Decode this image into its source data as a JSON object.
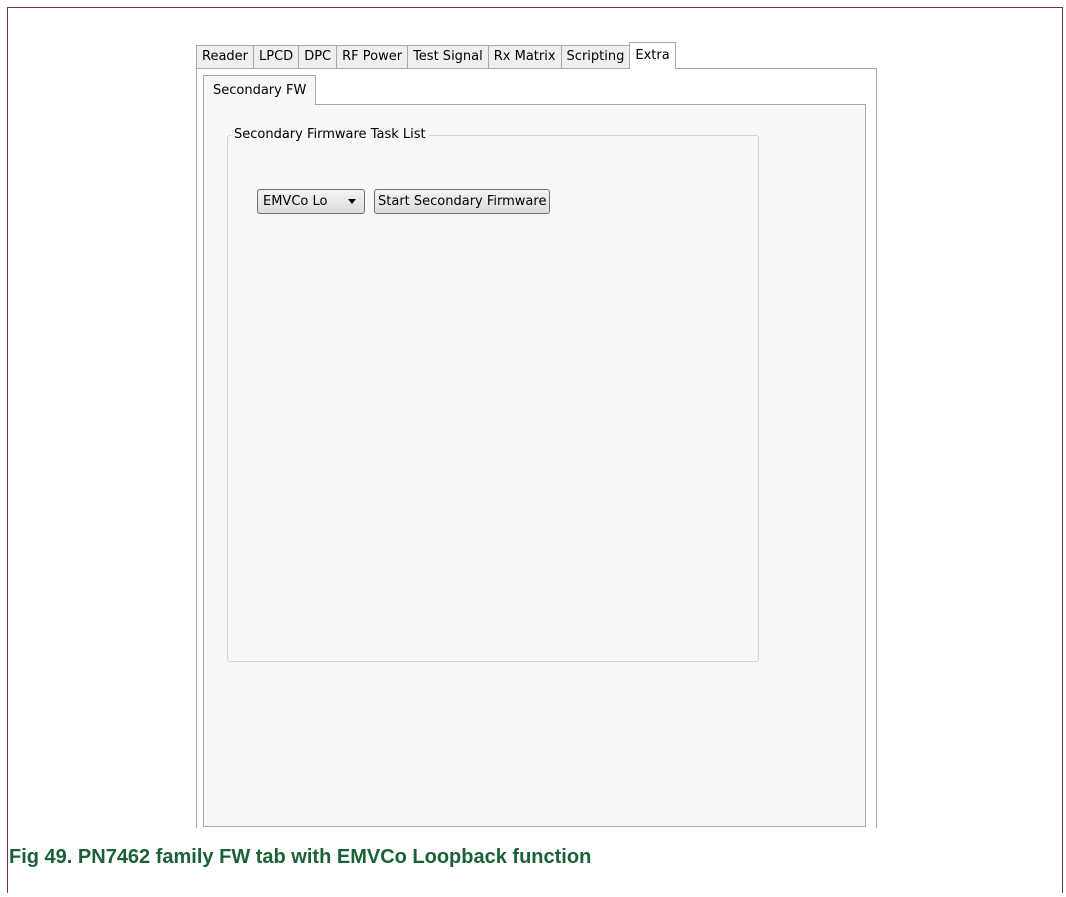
{
  "tabs": [
    "Reader",
    "LPCD",
    "DPC",
    "RF Power",
    "Test Signal",
    "Rx Matrix",
    "Scripting",
    "Extra"
  ],
  "active_tab": "Extra",
  "subtab": "Secondary FW",
  "group_title": "Secondary Firmware Task List",
  "dropdown_value": "EMVCo Lo",
  "start_button": "Start Secondary Firmware",
  "caption": "Fig 49. PN7462 family FW tab with EMVCo Loopback function",
  "colors": {
    "frame": "#7a2a63",
    "caption": "#1a6135"
  }
}
